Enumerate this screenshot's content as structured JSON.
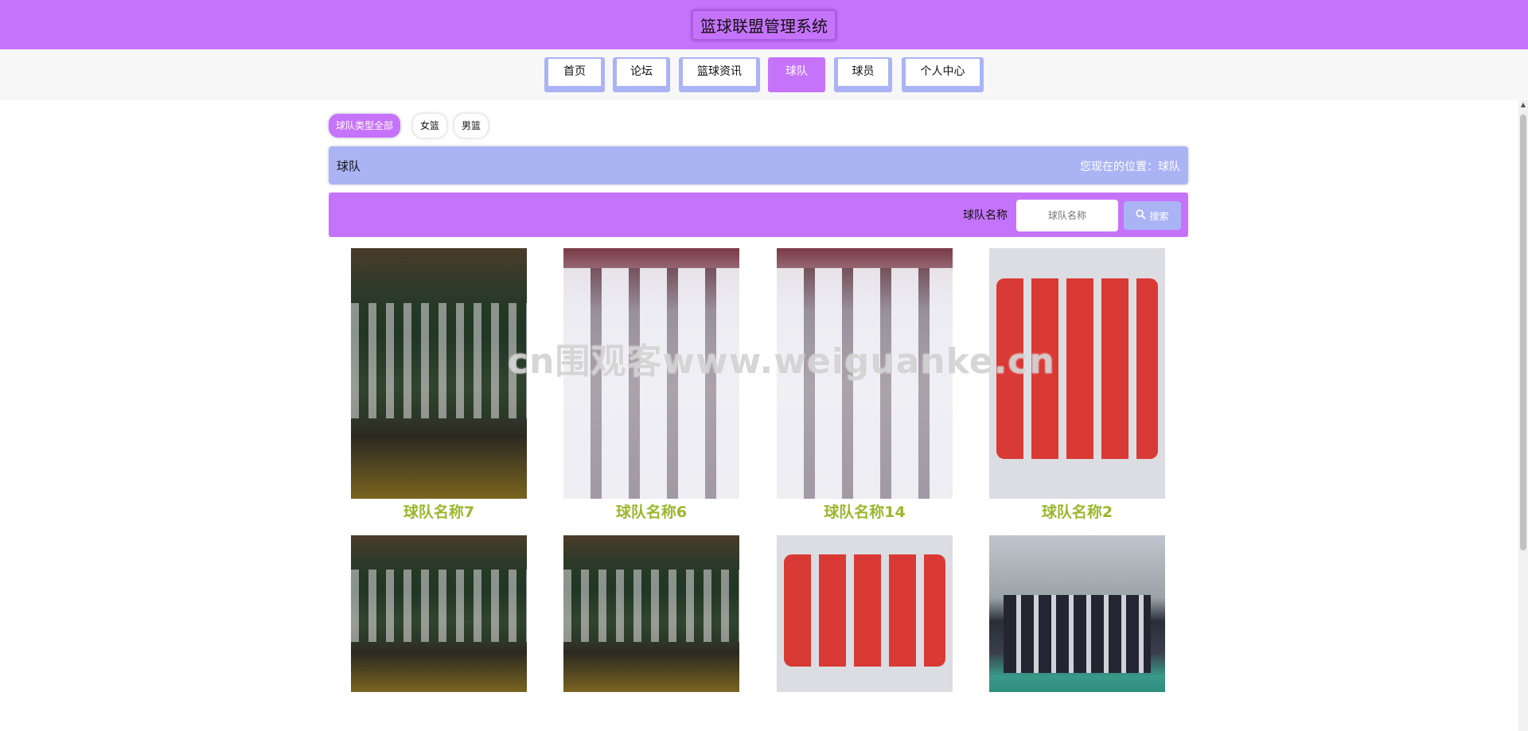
{
  "header": {
    "title": "篮球联盟管理系统"
  },
  "nav": {
    "items": [
      {
        "label": "首页"
      },
      {
        "label": "论坛"
      },
      {
        "label": "篮球资讯"
      },
      {
        "label": "球队"
      },
      {
        "label": "球员"
      },
      {
        "label": "个人中心"
      }
    ],
    "active_index": 3
  },
  "filters": [
    {
      "label": "球队类型全部"
    },
    {
      "label": "女篮"
    },
    {
      "label": "男篮"
    }
  ],
  "crumb": {
    "title": "球队",
    "location": "您现在的位置：球队"
  },
  "search": {
    "label": "球队名称",
    "placeholder": "球队名称",
    "button_label": "搜索"
  },
  "teams": [
    {
      "name": "球队名称7"
    },
    {
      "name": "球队名称6"
    },
    {
      "name": "球队名称14"
    },
    {
      "name": "球队名称2"
    },
    {
      "name": ""
    },
    {
      "name": ""
    },
    {
      "name": ""
    },
    {
      "name": ""
    }
  ],
  "watermark": "cn围观客www.weiguanke.cn",
  "colors": {
    "primary": "#c673fb",
    "secondary": "#aab4f5",
    "team_name": "#9ab72e"
  }
}
